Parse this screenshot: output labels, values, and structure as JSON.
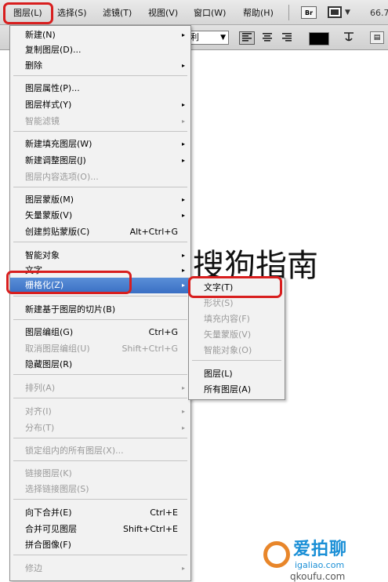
{
  "menubar": {
    "items": [
      {
        "label": "图层(L)"
      },
      {
        "label": "选择(S)"
      },
      {
        "label": "滤镜(T)"
      },
      {
        "label": "视图(V)"
      },
      {
        "label": "窗口(W)"
      },
      {
        "label": "帮助(H)"
      }
    ],
    "br_label": "Br",
    "zoom": "66.7"
  },
  "options_bar": {
    "antialias_value": "利",
    "warp_icon": "warp-text-icon"
  },
  "canvas": {
    "text": "搜狗指南"
  },
  "menu": {
    "items": [
      {
        "label": "新建(N)",
        "submenu": true
      },
      {
        "label": "复制图层(D)..."
      },
      {
        "label": "删除",
        "submenu": true
      },
      {
        "label": "图层属性(P)..."
      },
      {
        "label": "图层样式(Y)",
        "submenu": true
      },
      {
        "label": "智能滤镜",
        "submenu": true,
        "disabled": true
      },
      {
        "label": "新建填充图层(W)",
        "submenu": true
      },
      {
        "label": "新建调整图层(J)",
        "submenu": true
      },
      {
        "label": "图层内容选项(O)...",
        "disabled": true
      },
      {
        "label": "图层蒙版(M)",
        "submenu": true
      },
      {
        "label": "矢量蒙版(V)",
        "submenu": true
      },
      {
        "label": "创建剪贴蒙版(C)",
        "shortcut": "Alt+Ctrl+G"
      },
      {
        "label": "智能对象",
        "submenu": true
      },
      {
        "label": "文字",
        "submenu": true
      },
      {
        "label": "栅格化(Z)",
        "submenu": true,
        "highlighted": true
      },
      {
        "label": "新建基于图层的切片(B)"
      },
      {
        "label": "图层编组(G)",
        "shortcut": "Ctrl+G"
      },
      {
        "label": "取消图层编组(U)",
        "shortcut": "Shift+Ctrl+G",
        "disabled": true
      },
      {
        "label": "隐藏图层(R)"
      },
      {
        "label": "排列(A)",
        "submenu": true,
        "disabled": true
      },
      {
        "label": "对齐(I)",
        "submenu": true,
        "disabled": true
      },
      {
        "label": "分布(T)",
        "submenu": true,
        "disabled": true
      },
      {
        "label": "锁定组内的所有图层(X)...",
        "disabled": true
      },
      {
        "label": "链接图层(K)",
        "disabled": true
      },
      {
        "label": "选择链接图层(S)",
        "disabled": true
      },
      {
        "label": "向下合并(E)",
        "shortcut": "Ctrl+E"
      },
      {
        "label": "合并可见图层",
        "shortcut": "Shift+Ctrl+E"
      },
      {
        "label": "拼合图像(F)"
      },
      {
        "label": "修边",
        "submenu": true,
        "disabled": true
      }
    ],
    "submenu_arrow": "▸"
  },
  "submenu": {
    "items": [
      {
        "label": "文字(T)"
      },
      {
        "label": "形状(S)",
        "disabled": true
      },
      {
        "label": "填充内容(F)",
        "disabled": true
      },
      {
        "label": "矢量蒙版(V)",
        "disabled": true
      },
      {
        "label": "智能对象(O)",
        "disabled": true
      },
      {
        "label": "图层(L)"
      },
      {
        "label": "所有图层(A)"
      }
    ]
  },
  "watermark": {
    "title": "爱拍聊",
    "url": "igaliao.com",
    "url2": "qkoufu.com"
  },
  "colors": {
    "highlight": "#3a6fc4",
    "annotation_ring": "#d81e1e",
    "watermark_blue": "#1a8fd6"
  }
}
